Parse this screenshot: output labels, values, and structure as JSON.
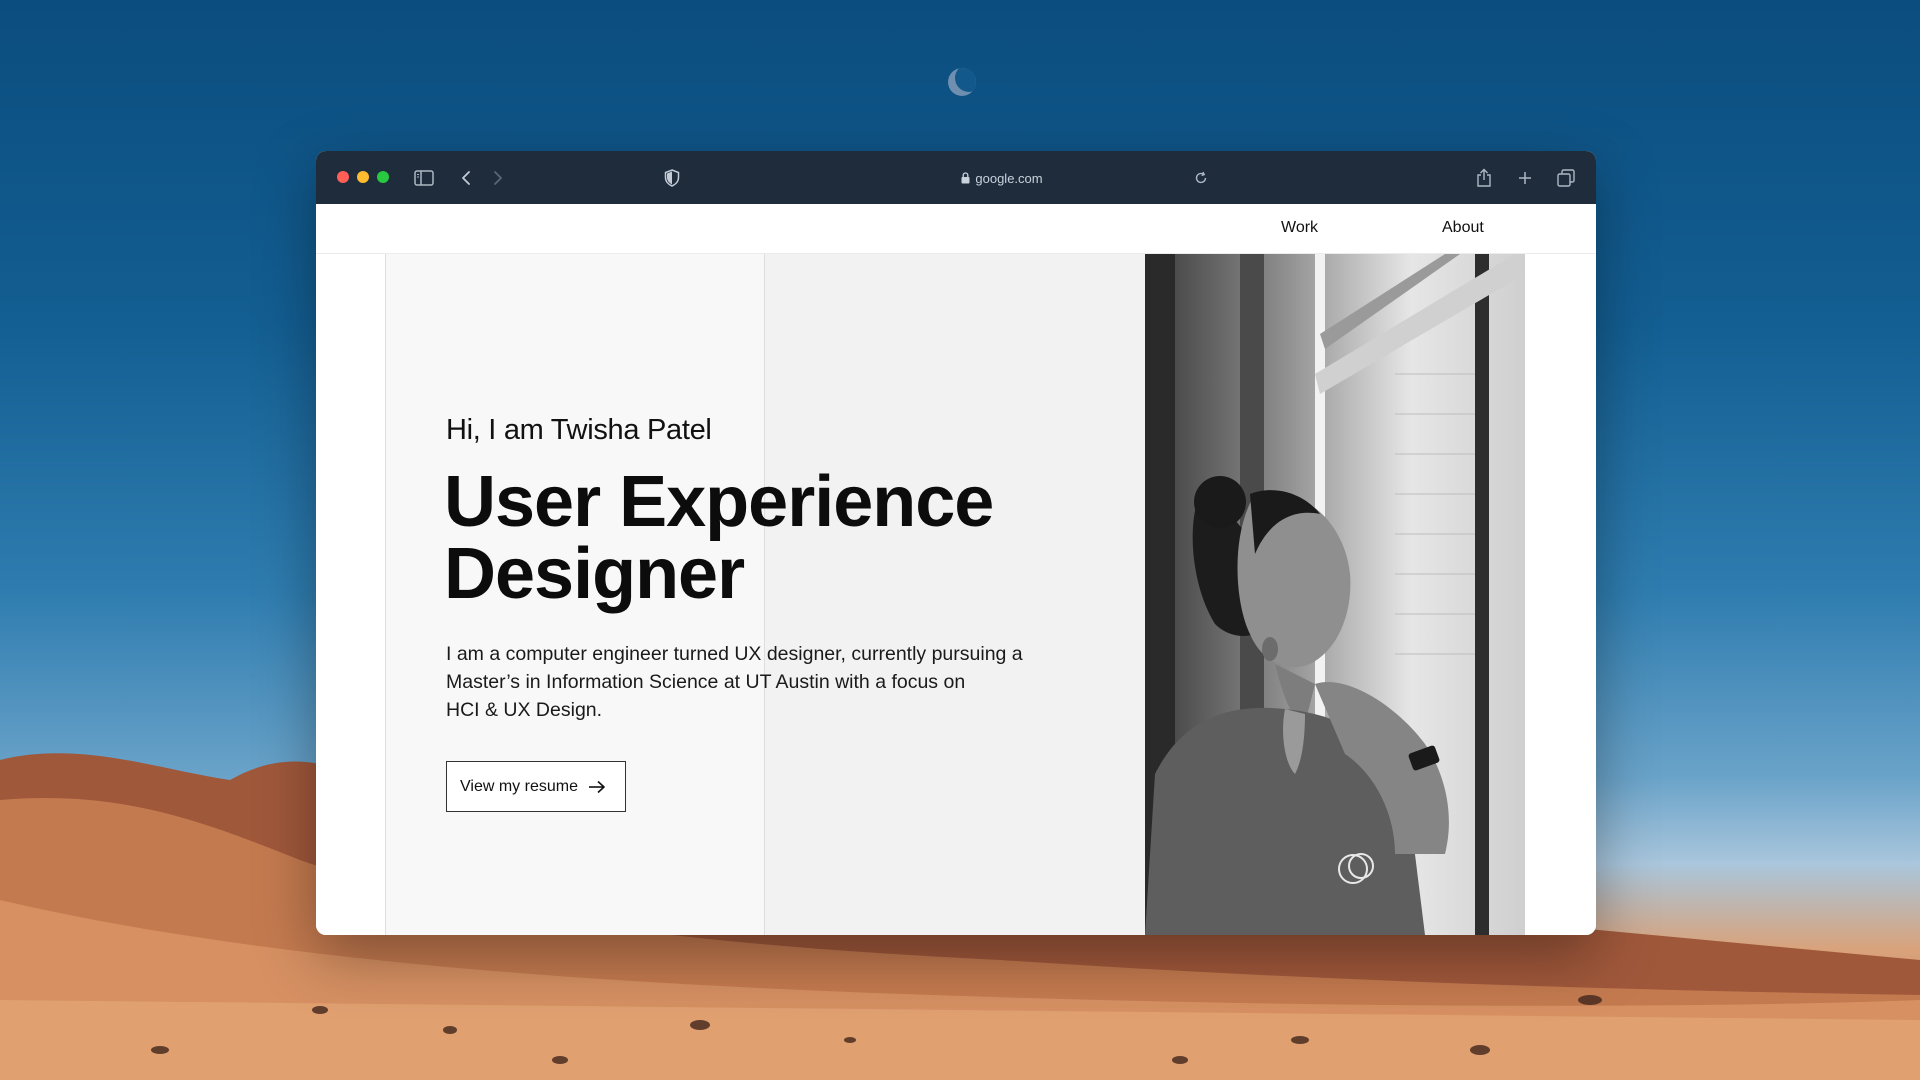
{
  "browser": {
    "url": "google.com"
  },
  "nav": {
    "work": "Work",
    "about": "About"
  },
  "hero": {
    "greeting": "Hi, I am Twisha Patel",
    "headline_line1": "User Experience",
    "headline_line2": "Designer",
    "bio_line1": "I am a computer engineer turned UX designer, currently pursuing a",
    "bio_line2": "Master’s in Information Science at UT Austin with a focus on",
    "bio_line3": "HCI & UX Design.",
    "cta_label": "View my resume"
  },
  "icons": {
    "sidebar": "sidebar-toggle-icon",
    "back": "chevron-left-icon",
    "forward": "chevron-right-icon",
    "privacy": "shield-icon",
    "lock": "lock-icon",
    "reload": "reload-icon",
    "share": "share-icon",
    "new_tab": "plus-icon",
    "tabs": "tab-overview-icon",
    "cta_arrow": "arrow-right-icon"
  },
  "colors": {
    "toolbar": "#1f2c3c",
    "close": "#ff5f57",
    "minimize": "#febc2e",
    "zoom": "#28c840"
  }
}
